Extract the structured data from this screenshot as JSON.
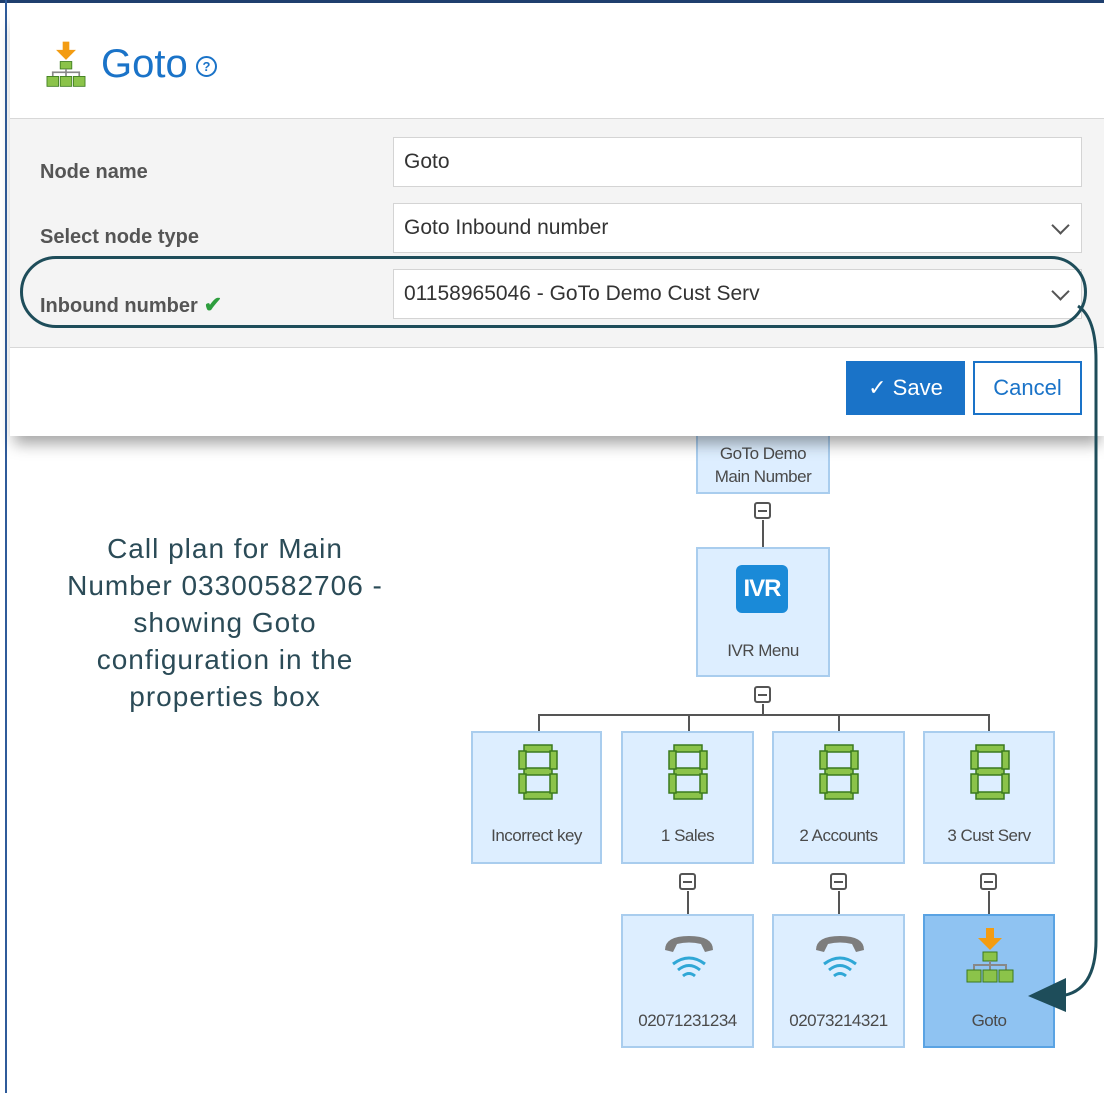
{
  "dialog": {
    "title": "Goto",
    "help": "?",
    "fields": {
      "node_name_label": "Node name",
      "node_name_value": "Goto",
      "node_type_label": "Select node type",
      "node_type_value": "Goto Inbound number",
      "inbound_label": "Inbound number",
      "inbound_value": "01158965046 - GoTo Demo Cust Serv"
    },
    "save_label": "✓ Save",
    "cancel_label": "Cancel"
  },
  "caption": {
    "lines": [
      "Call plan for Main",
      "Number 03300582706 -",
      "showing Goto",
      "configuration in the",
      "properties box"
    ]
  },
  "tree": {
    "root": {
      "line1": "GoTo Demo",
      "line2": "Main Number"
    },
    "ivr": {
      "badge": "IVR",
      "label": "IVR Menu"
    },
    "keys": [
      "Incorrect key",
      "1 Sales",
      "2 Accounts",
      "3 Cust Serv"
    ],
    "digit_glyph": "8",
    "leaves": [
      "02071231234",
      "02073214321",
      "Goto"
    ]
  },
  "colors": {
    "accent": "#1a73c8",
    "node_fill": "#ddeeff",
    "node_selected": "#8fc3f2",
    "annotation": "#1e4d5a",
    "digit_green": "#8bc34a",
    "check_green": "#2e9e3e"
  },
  "icons": {
    "title": "goto-org-icon",
    "help": "help-circle-icon",
    "check": "checkmark-icon",
    "dropdown": "chevron-down-icon",
    "ivr": "ivr-icon",
    "key": "seven-segment-digit-icon",
    "phone": "telephone-icon",
    "goto": "goto-org-icon"
  }
}
